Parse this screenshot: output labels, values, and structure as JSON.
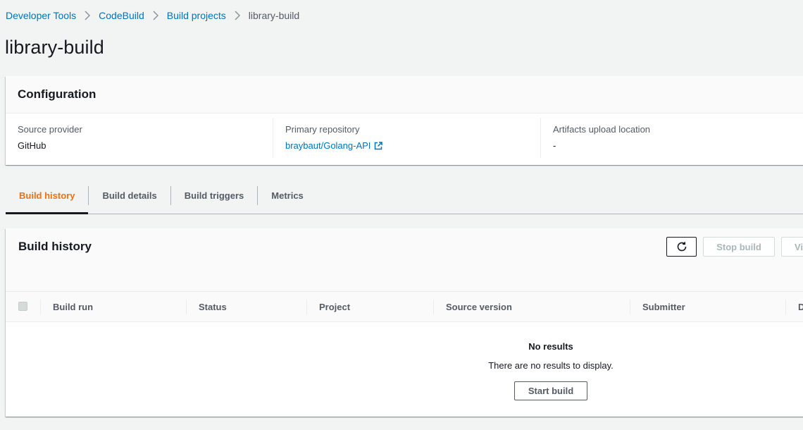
{
  "breadcrumb": {
    "items": [
      {
        "label": "Developer Tools"
      },
      {
        "label": "CodeBuild"
      },
      {
        "label": "Build projects"
      }
    ],
    "current": "library-build"
  },
  "page": {
    "title": "library-build"
  },
  "configuration": {
    "title": "Configuration",
    "source_provider_label": "Source provider",
    "source_provider_value": "GitHub",
    "primary_repository_label": "Primary repository",
    "primary_repository_value": "braybaut/Golang-API",
    "artifacts_label": "Artifacts upload location",
    "artifacts_value": "-"
  },
  "tabs": [
    {
      "label": "Build history",
      "active": true
    },
    {
      "label": "Build details",
      "active": false
    },
    {
      "label": "Build triggers",
      "active": false
    },
    {
      "label": "Metrics",
      "active": false
    }
  ],
  "history": {
    "title": "Build history",
    "stop_build_label": "Stop build",
    "view_label": "Vi",
    "columns": [
      "Build run",
      "Status",
      "Project",
      "Source version",
      "Submitter",
      "D"
    ],
    "empty_title": "No results",
    "empty_message": "There are no results to display.",
    "start_build_label": "Start build"
  },
  "colors": {
    "link": "#0073bb",
    "active_tab": "#ec7211",
    "background": "#f2f3f3"
  }
}
